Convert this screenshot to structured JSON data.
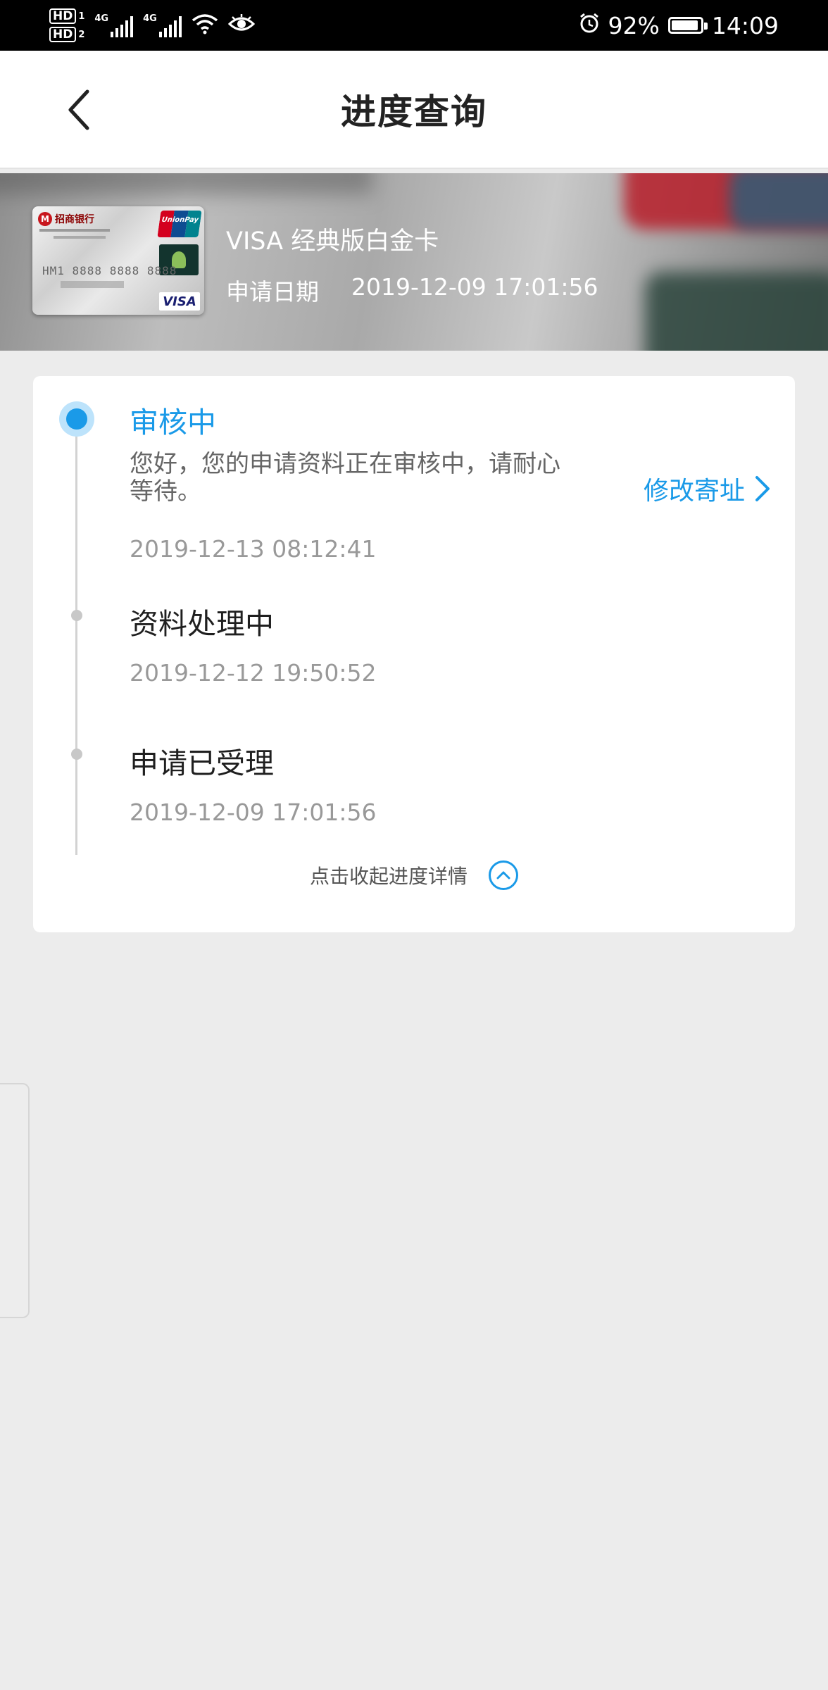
{
  "status_bar": {
    "hd1": "HD",
    "hd1_sub": "1",
    "hd2": "HD",
    "hd2_sub": "2",
    "net1": "4G",
    "net2": "4G",
    "battery_percent": "92%",
    "battery_level": 0.92,
    "time": "14:09",
    "icons": [
      "signal-icon",
      "wifi-icon",
      "eye-icon",
      "alarm-icon",
      "battery-icon"
    ]
  },
  "header": {
    "title": "进度查询",
    "back_icon": "chevron-left-icon"
  },
  "card": {
    "name": "VISA 经典版白金卡",
    "apply_date_label": "申请日期",
    "apply_date": "2019-12-09 17:01:56",
    "bank_name": "招商银行",
    "card_number": "HM1 8888 8888 8888",
    "network": "VISA",
    "unionpay_label": "UnionPay"
  },
  "timeline": {
    "items": [
      {
        "title": "审核中",
        "desc": "您好，您的申请资料正在审核中，请耐心等待。",
        "time": "2019-12-13 08:12:41",
        "active": true
      },
      {
        "title": "资料处理中",
        "time": "2019-12-12 19:50:52",
        "active": false
      },
      {
        "title": "申请已受理",
        "time": "2019-12-09 17:01:56",
        "active": false
      }
    ],
    "action_label": "修改寄址",
    "collapse_label": "点击收起进度详情"
  },
  "colors": {
    "accent": "#1a9ae8",
    "background": "#ececec",
    "muted_text": "#999999"
  }
}
